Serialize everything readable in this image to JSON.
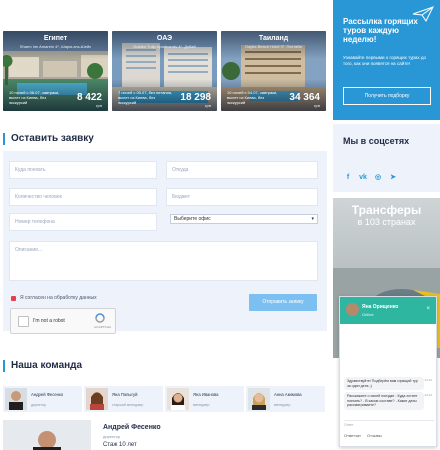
{
  "tours": [
    {
      "country": "Египет",
      "hotel": "Sharm Inn Amarein 4*, Шарм-эль-Шейх",
      "details": "10 ночей с 06.07, завтраки, вылет из Киева, без экскурсий",
      "price": "8 422",
      "currency": "грн"
    },
    {
      "country": "ОАЭ",
      "hotel": "Golden Tulip Apartments 4*, Дубай",
      "details": "7 ночей с 05.07, без питания, вылет из Киева, без экскурсий",
      "price": "18 298",
      "currency": "грн"
    },
    {
      "country": "Таиланд",
      "hotel": "Daytia Beach Hotel 3*, Паттайя",
      "details": "10 ночей с 04.07, завтраки, вылет из Киева, без экскурсий",
      "price": "34 364",
      "currency": "грн"
    }
  ],
  "subscribe": {
    "title": "Рассылка горящих туров каждую неделю!",
    "text": "Узнавайте первыми о горящих турах до того, как они появятся на сайте!",
    "button": "Получить подборку"
  },
  "request": {
    "title": "Оставить заявку",
    "fields": {
      "where": "Куда поехать",
      "from": "Откуда",
      "people": "Количество человек",
      "budget": "Бюджет",
      "phone": "Номер телефона",
      "office": "Выберите офис",
      "message": "Описание..."
    },
    "agree": "Я согласен на обработку данных",
    "send": "Отправить заявку",
    "captcha": {
      "label": "I'm not a robot",
      "brand": "reCAPTCHA"
    }
  },
  "social": {
    "title": "Мы в соцсетях",
    "icons": [
      "facebook-icon",
      "vk-icon",
      "instagram-icon",
      "telegram-icon"
    ]
  },
  "transfer": {
    "line1": "Трансферы",
    "line2": "в 103 странах"
  },
  "chat": {
    "name": "Яна Орищенко",
    "status": "Online",
    "close": "×",
    "messages": [
      {
        "text": "Здравствуйте! Подберём вам горящий тур за один день ;)",
        "time": "14:12"
      },
      {
        "text": "Расскажите о своей поездке - Куда хотите поехать? - В каком составе? - Какие даты рассматриваете?",
        "time": "14:12"
      }
    ],
    "input": "Ответ",
    "tabs": [
      "Ответчат",
      "Отзывы"
    ]
  },
  "team": {
    "title": "Наша команда",
    "members": [
      {
        "name": "Андрей Фесенко",
        "role": "директор"
      },
      {
        "name": "Яна Попыгуй",
        "role": "старший менеджер"
      },
      {
        "name": "Яна Иванова",
        "role": "менеджер"
      },
      {
        "name": "Анна Акимова",
        "role": "менеджер"
      }
    ],
    "featured": {
      "name": "Андрей Фесенко",
      "role": "директор",
      "experience": "Стаж 10 лет"
    }
  },
  "colors": {
    "accent": "#2997d6",
    "chat": "#2fb6a0",
    "button": "#7cc0f1"
  }
}
